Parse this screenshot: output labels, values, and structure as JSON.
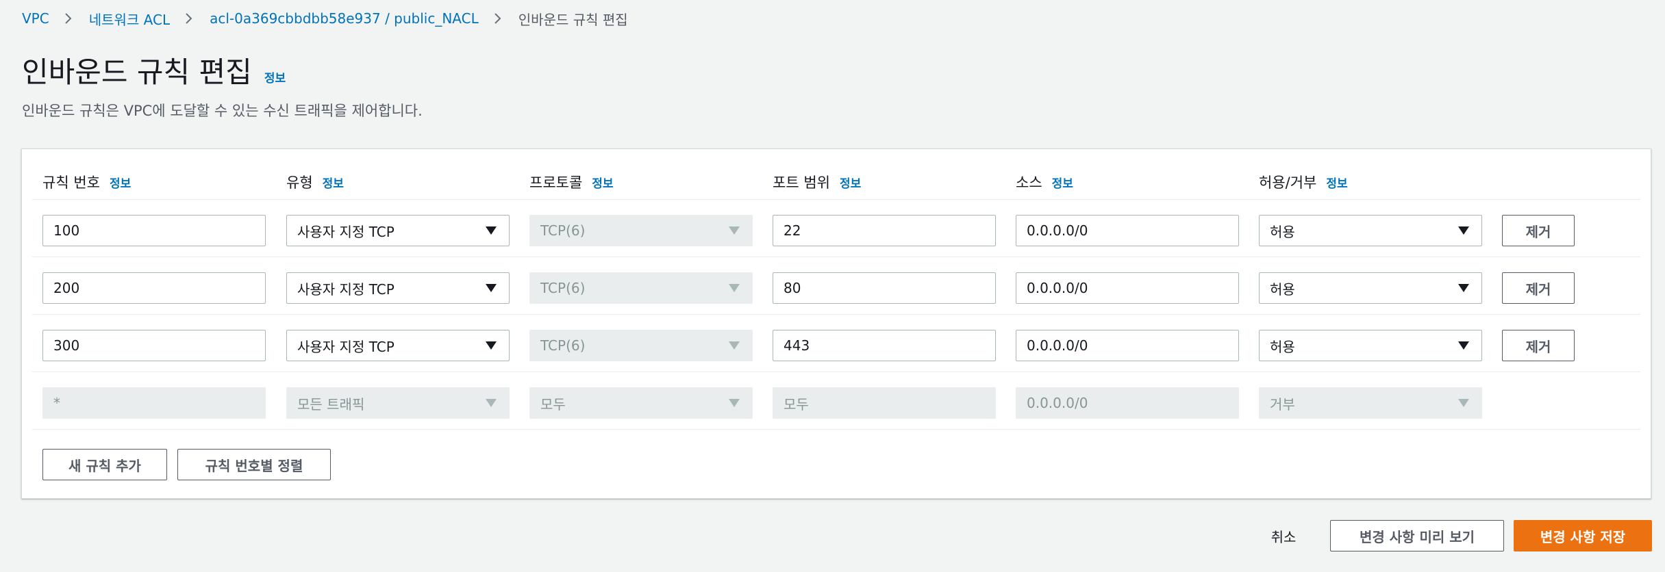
{
  "breadcrumb": {
    "items": [
      "VPC",
      "네트워크 ACL",
      "acl-0a369cbbdbb58e937 / public_NACL"
    ],
    "current": "인바운드 규칙 편집"
  },
  "header": {
    "title": "인바운드 규칙 편집",
    "info": "정보",
    "description": "인바운드 규칙은 VPC에 도달할 수 있는 수신 트래픽을 제어합니다."
  },
  "table": {
    "columns": [
      {
        "label": "규칙 번호",
        "info": "정보"
      },
      {
        "label": "유형",
        "info": "정보"
      },
      {
        "label": "프로토콜",
        "info": "정보"
      },
      {
        "label": "포트 범위",
        "info": "정보"
      },
      {
        "label": "소스",
        "info": "정보"
      },
      {
        "label": "허용/거부",
        "info": "정보"
      }
    ],
    "rows": [
      {
        "rule": "100",
        "type": "사용자 지정 TCP",
        "protocol": "TCP(6)",
        "port": "22",
        "source": "0.0.0.0/0",
        "action": "허용",
        "remove": "제거"
      },
      {
        "rule": "200",
        "type": "사용자 지정 TCP",
        "protocol": "TCP(6)",
        "port": "80",
        "source": "0.0.0.0/0",
        "action": "허용",
        "remove": "제거"
      },
      {
        "rule": "300",
        "type": "사용자 지정 TCP",
        "protocol": "TCP(6)",
        "port": "443",
        "source": "0.0.0.0/0",
        "action": "허용",
        "remove": "제거"
      }
    ],
    "default_row": {
      "rule": "*",
      "type": "모든 트래픽",
      "protocol": "모두",
      "port": "모두",
      "source": "0.0.0.0/0",
      "action": "거부"
    },
    "add_rule": "새 규칙 추가",
    "sort_rules": "규칙 번호별 정렬"
  },
  "footer": {
    "cancel": "취소",
    "preview": "변경 사항 미리 보기",
    "save": "변경 사항 저장"
  },
  "colors": {
    "link": "#0073bb",
    "primary": "#ec7211",
    "background": "#f2f3f3",
    "disabled_field": "#eaeded"
  },
  "icons": {
    "breadcrumb_separator": "chevron-right-icon",
    "select_arrow": "caret-down-icon"
  }
}
